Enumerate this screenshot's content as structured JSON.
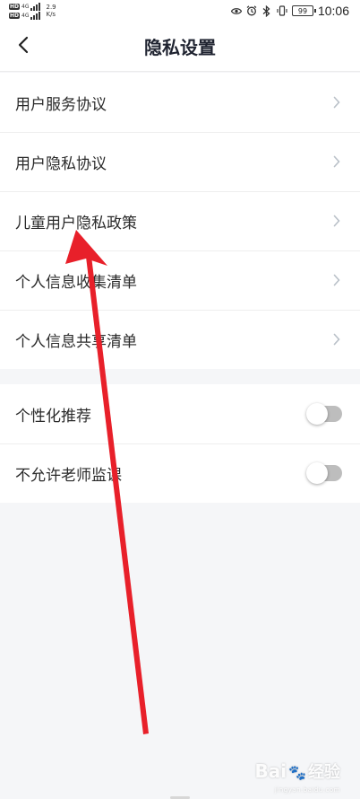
{
  "status_bar": {
    "sim1": {
      "hd": "HD",
      "net": "4G"
    },
    "sim2": {
      "hd": "HD",
      "net": "4G"
    },
    "speed_value": "2.9",
    "speed_unit": "K/s",
    "battery": "99",
    "time": "10:06"
  },
  "header": {
    "title": "隐私设置"
  },
  "links": [
    {
      "label": "用户服务协议"
    },
    {
      "label": "用户隐私协议"
    },
    {
      "label": "儿童用户隐私政策"
    },
    {
      "label": "个人信息收集清单"
    },
    {
      "label": "个人信息共享清单"
    }
  ],
  "toggles": [
    {
      "label": "个性化推荐",
      "on": false
    },
    {
      "label": "不允许老师监课",
      "on": false
    }
  ],
  "watermark": {
    "brand": "Bai",
    "suffix": "经验",
    "sub": "jingyan.baidu.com"
  },
  "colors": {
    "annotation_arrow": "#e8202a",
    "toggle_off": "#bdbdbd",
    "page_bg": "#f5f6f8"
  }
}
